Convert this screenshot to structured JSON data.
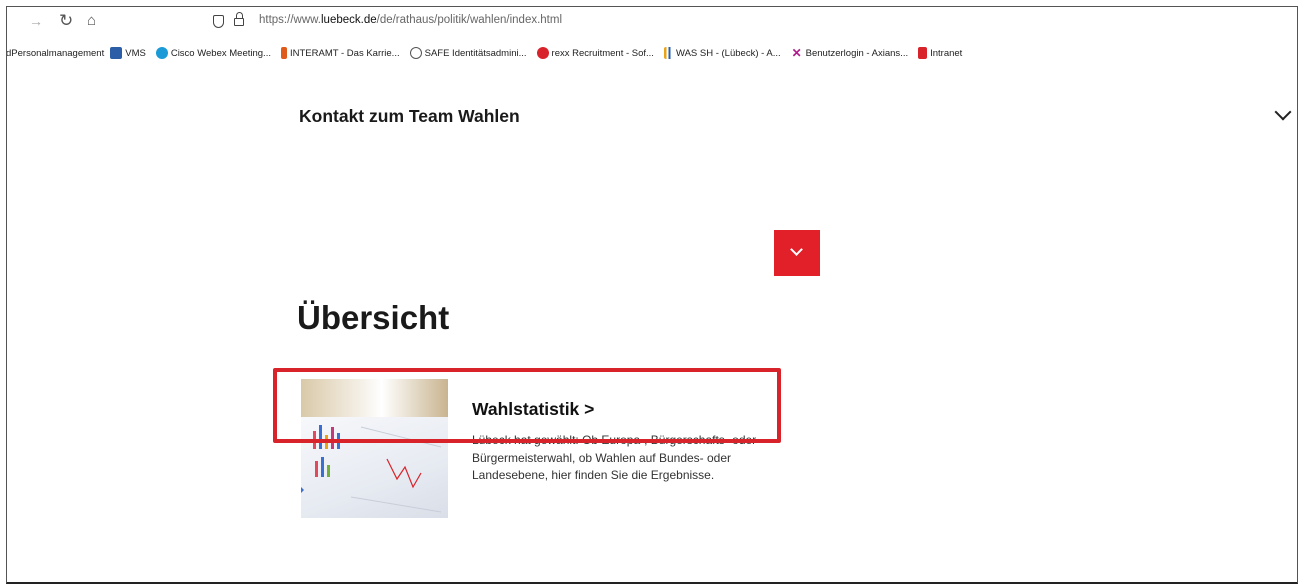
{
  "browser": {
    "url_prefix": "https://www.",
    "url_domain": "luebeck.de",
    "url_path": "/de/rathaus/politik/wahlen/index.html"
  },
  "bookmarks": [
    {
      "label": "dPersonalmanagement",
      "icon": "none",
      "color": ""
    },
    {
      "label": "VMS",
      "icon": "vms-icon",
      "color": "#2b5ea7"
    },
    {
      "label": "Cisco Webex Meeting...",
      "icon": "webex-icon",
      "color": "#1a9bd7"
    },
    {
      "label": "INTERAMT - Das Karrie...",
      "icon": "interamt-icon",
      "color": "#e05a1c"
    },
    {
      "label": "SAFE Identitätsadmini...",
      "icon": "globe-icon",
      "color": "#555555"
    },
    {
      "label": "rexx Recruitment - Sof...",
      "icon": "rexx-icon",
      "color": "#d8232a"
    },
    {
      "label": "WAS SH - (Lübeck) - A...",
      "icon": "chart-icon",
      "color": "#e8a317"
    },
    {
      "label": "Benutzerlogin - Axians...",
      "icon": "axians-icon",
      "color": "#b0198a"
    },
    {
      "label": "Intranet",
      "icon": "intranet-icon",
      "color": "#d8232a"
    }
  ],
  "content": {
    "contact_heading": "Kontakt zum Team Wahlen",
    "overview_heading": "Übersicht",
    "card_title": "Wahlstatistik >",
    "card_description": "Lübeck hat gewählt: Ob Europa-, Bürgerschafts- oder Bürgermeisterwahl, ob Wahlen auf Bundes- oder Landesebene, hier finden Sie die Ergebnisse."
  },
  "colors": {
    "accent_red": "#e2202a",
    "highlight_red": "#d8232a"
  }
}
